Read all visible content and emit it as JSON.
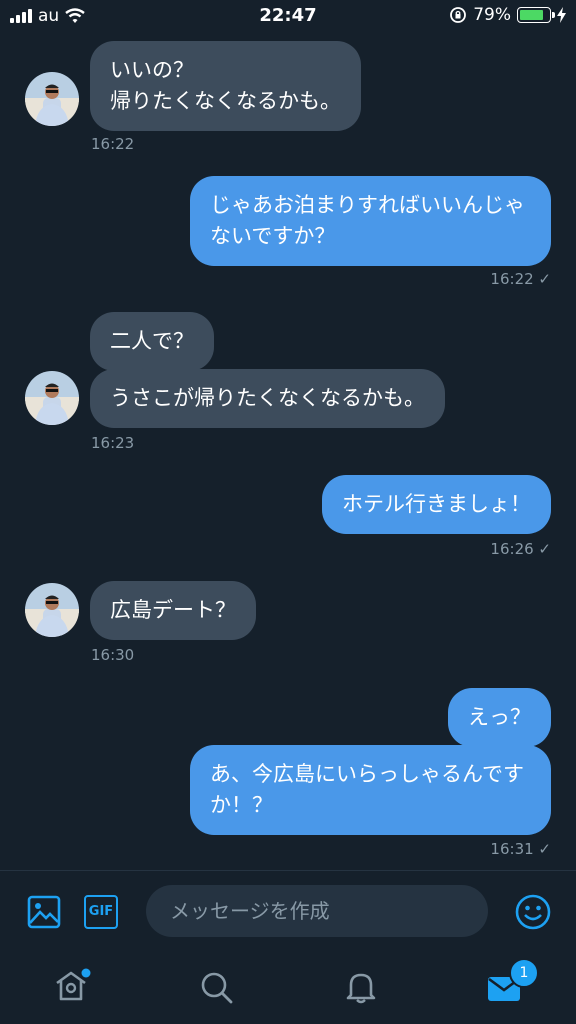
{
  "status_bar": {
    "carrier": "au",
    "time": "22:47",
    "battery": "79%"
  },
  "messages": [
    {
      "side": "in",
      "lines": [
        "いいの？",
        "帰りたくなくなるかも。"
      ]
    },
    {
      "time": "16:22"
    },
    {
      "side": "out",
      "lines": [
        "じゃあお泊まりすればいいんじゃ",
        "ないですか？"
      ]
    },
    {
      "time": "16:22 ✓"
    },
    {
      "side": "in",
      "lines": [
        "二人で？"
      ]
    },
    {
      "side": "in",
      "lines": [
        "うさこが帰りたくなくなるかも。"
      ]
    },
    {
      "time": "16:23"
    },
    {
      "side": "out",
      "lines": [
        "ホテル行きましょ！"
      ]
    },
    {
      "time": "16:26 ✓"
    },
    {
      "side": "in",
      "lines": [
        "広島デート？"
      ]
    },
    {
      "time": "16:30"
    },
    {
      "side": "out",
      "lines": [
        "えっ？"
      ]
    },
    {
      "side": "out",
      "lines": [
        "あ、今広島にいらっしゃるんです",
        "か！？"
      ]
    },
    {
      "time": "16:31 ✓"
    }
  ],
  "composer": {
    "placeholder": "メッセージを作成",
    "gif_label": "GIF"
  },
  "tab_bar": {
    "items": [
      "home-icon",
      "search-icon",
      "notifications-icon",
      "messages-icon"
    ],
    "messages_badge": "1"
  },
  "colors": {
    "background": "#15202b",
    "incoming": "#3d4c5c",
    "outgoing": "#4a98e9",
    "accent": "#1da1f2",
    "muted": "#8899a6"
  }
}
